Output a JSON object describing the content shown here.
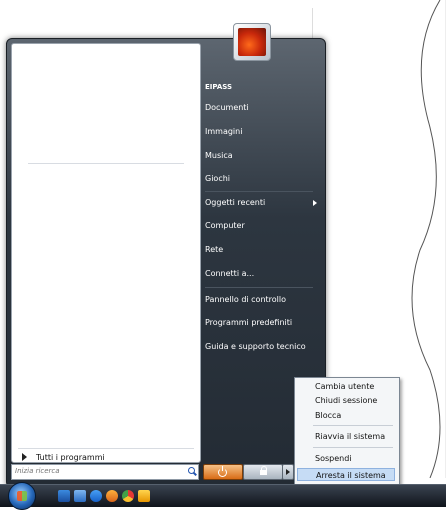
{
  "user": {
    "name": "EIPASS"
  },
  "right_items": [
    "Documenti",
    "Immagini",
    "Musica",
    "Giochi",
    "Oggetti recenti",
    "Computer",
    "Rete",
    "Connetti a...",
    "Pannello di controllo",
    "Programmi predefiniti",
    "Guida e supporto tecnico"
  ],
  "all_programs": "Tutti i programmi",
  "search": {
    "placeholder": "Inizia ricerca",
    "value": ""
  },
  "power_menu": [
    "Cambia utente",
    "Chiudi sessione",
    "Blocca",
    "Riavvia il sistema",
    "Sospendi",
    "Arresta il sistema"
  ],
  "highlighted_power_item": "Arresta il sistema",
  "icons": {
    "user_picture": "user-avatar",
    "power": "power-icon",
    "lock": "lock-icon",
    "arrow": "arrow-right-icon",
    "search": "search-icon",
    "start": "start-orb-icon"
  },
  "colors": {
    "menu_dark": "#2d3640",
    "power_button": "#d86c16",
    "highlight": "#c6dcf5"
  }
}
